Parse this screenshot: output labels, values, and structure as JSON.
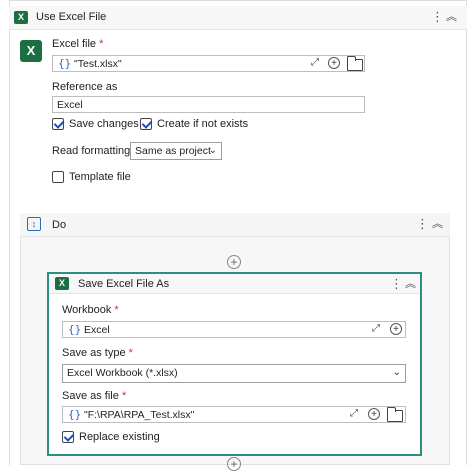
{
  "use_excel_file": {
    "title": "Use Excel File",
    "excel_file_label": "Excel file",
    "required_mark": "*",
    "excel_file_value": "\"Test.xlsx\"",
    "reference_label": "Reference as",
    "reference_value": "Excel",
    "save_changes_label": "Save changes",
    "save_changes_checked": true,
    "create_if_not_exists_label": "Create if not exists",
    "create_if_not_exists_checked": true,
    "read_formatting_label": "Read formatting",
    "read_formatting_value": "Same as project",
    "template_file_label": "Template file",
    "template_file_checked": false
  },
  "do_block": {
    "title": "Do"
  },
  "save_excel_file_as": {
    "title": "Save Excel File As",
    "workbook_label": "Workbook",
    "workbook_value": "Excel",
    "save_as_type_label": "Save as type",
    "save_as_type_value": "Excel Workbook (*.xlsx)",
    "save_as_file_label": "Save as file",
    "save_as_file_value": "\"F:\\RPA\\RPA_Test.xlsx\"",
    "replace_existing_label": "Replace existing",
    "replace_existing_checked": true
  },
  "icons": {
    "excel": "X",
    "braces": "{}",
    "plus": "+",
    "kebab": "⋮",
    "collapse": "︽",
    "dropdown": "⌄",
    "expand": "⤢",
    "do": "↕"
  },
  "colors": {
    "excel_green": "#1d6f42",
    "selection_border": "#2a8f7f",
    "required": "#c0392b",
    "braces_blue": "#3366cc"
  }
}
